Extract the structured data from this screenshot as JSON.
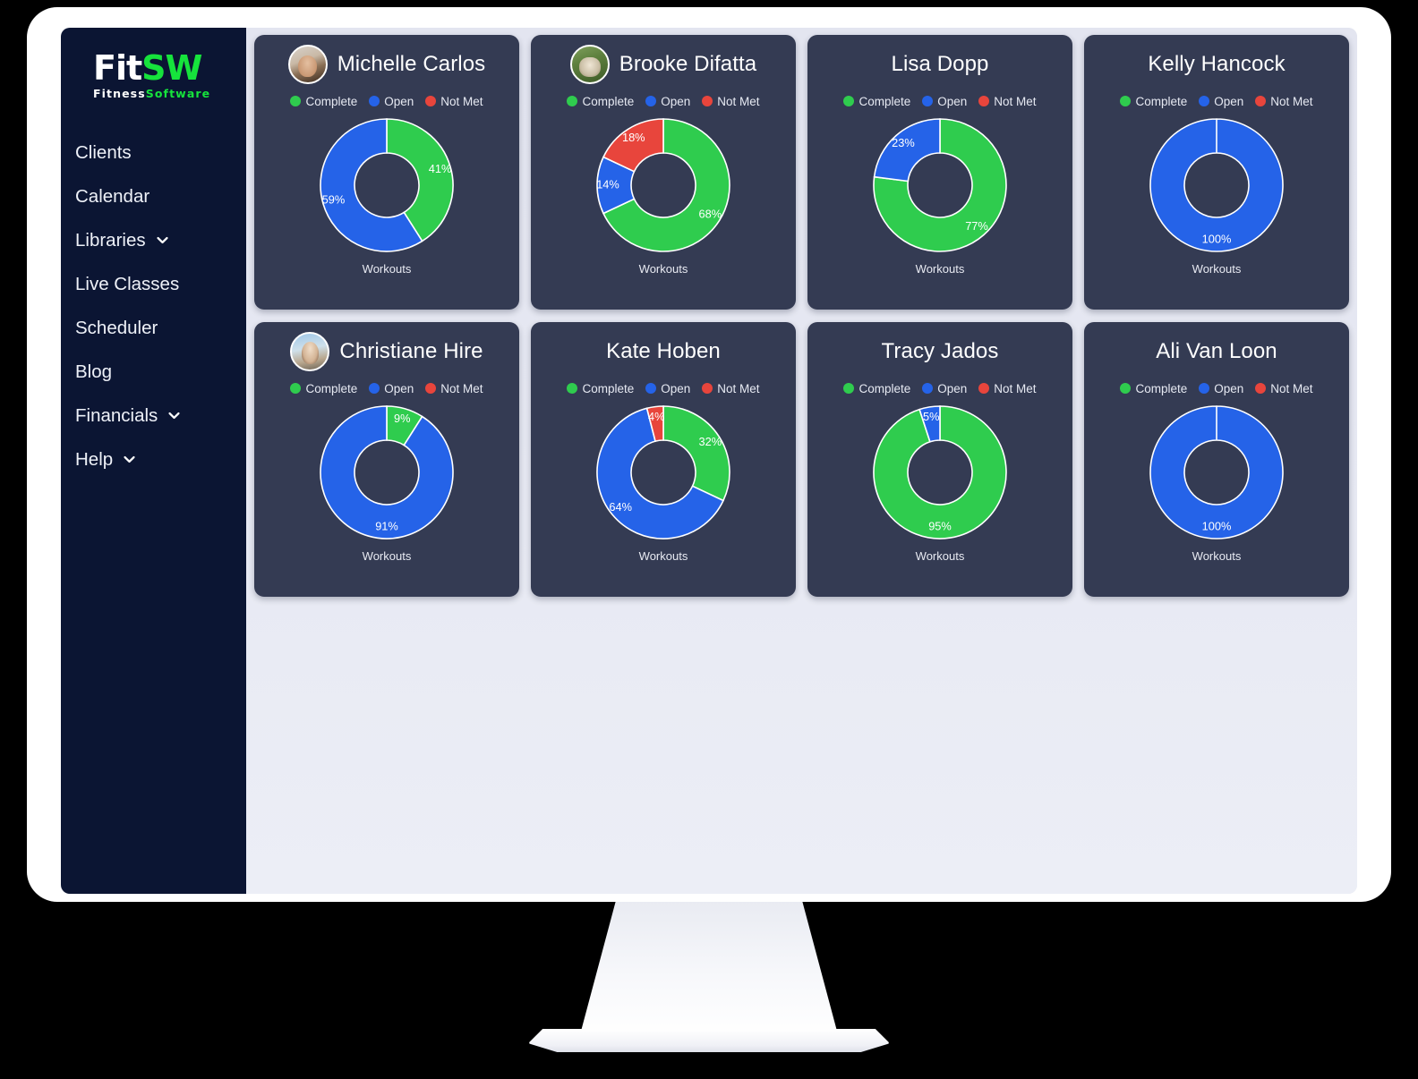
{
  "brand": {
    "logo_text_1": "Fit",
    "logo_text_2": "SW",
    "logo_sub_1": "Fitness",
    "logo_sub_2": "Software",
    "color_green": "#16e33c",
    "color_white": "#ffffff"
  },
  "sidebar": {
    "items": [
      {
        "label": "Clients",
        "has_chevron": false
      },
      {
        "label": "Calendar",
        "has_chevron": false
      },
      {
        "label": "Libraries",
        "has_chevron": true
      },
      {
        "label": "Live Classes",
        "has_chevron": false
      },
      {
        "label": "Scheduler",
        "has_chevron": false
      },
      {
        "label": "Blog",
        "has_chevron": false
      },
      {
        "label": "Financials",
        "has_chevron": true
      },
      {
        "label": "Help",
        "has_chevron": true
      }
    ]
  },
  "legend": {
    "complete": "Complete",
    "open": "Open",
    "not_met": "Not Met"
  },
  "colors": {
    "complete": "#2fcc4e",
    "open": "#2563e8",
    "not_met": "#e8453c",
    "card_bg": "#343b53",
    "sidebar_bg": "#0b1533",
    "page_bg": "#e3e5f0",
    "donut_hole": "#343b53",
    "separator": "#ffffff"
  },
  "chart_data": [
    {
      "type": "pie",
      "title": "Michelle Carlos",
      "caption": "Workouts",
      "has_avatar": true,
      "categories": [
        "Complete",
        "Open",
        "Not Met"
      ],
      "values": [
        41,
        59,
        0
      ],
      "labels": [
        "41%",
        "59%",
        ""
      ],
      "colors": [
        "#2fcc4e",
        "#2563e8",
        "#e8453c"
      ]
    },
    {
      "type": "pie",
      "title": "Brooke Difatta",
      "caption": "Workouts",
      "has_avatar": true,
      "categories": [
        "Complete",
        "Open",
        "Not Met"
      ],
      "values": [
        68,
        14,
        18
      ],
      "labels": [
        "68%",
        "14%",
        "18%"
      ],
      "colors": [
        "#2fcc4e",
        "#2563e8",
        "#e8453c"
      ]
    },
    {
      "type": "pie",
      "title": "Lisa Dopp",
      "caption": "Workouts",
      "has_avatar": false,
      "categories": [
        "Complete",
        "Open",
        "Not Met"
      ],
      "values": [
        77,
        23,
        0
      ],
      "labels": [
        "77%",
        "23%",
        ""
      ],
      "colors": [
        "#2fcc4e",
        "#2563e8",
        "#e8453c"
      ]
    },
    {
      "type": "pie",
      "title": "Kelly Hancock",
      "caption": "Workouts",
      "has_avatar": false,
      "categories": [
        "Complete",
        "Open",
        "Not Met"
      ],
      "values": [
        0,
        100,
        0
      ],
      "labels": [
        "",
        "100%",
        ""
      ],
      "colors": [
        "#2fcc4e",
        "#2563e8",
        "#e8453c"
      ]
    },
    {
      "type": "pie",
      "title": "Christiane Hire",
      "caption": "Workouts",
      "has_avatar": true,
      "categories": [
        "Complete",
        "Open",
        "Not Met"
      ],
      "values": [
        9,
        91,
        0
      ],
      "labels": [
        "9%",
        "91%",
        ""
      ],
      "colors": [
        "#2fcc4e",
        "#2563e8",
        "#e8453c"
      ]
    },
    {
      "type": "pie",
      "title": "Kate Hoben",
      "caption": "Workouts",
      "has_avatar": false,
      "categories": [
        "Complete",
        "Open",
        "Not Met"
      ],
      "values": [
        32,
        64,
        4
      ],
      "labels": [
        "32%",
        "64%",
        "4%"
      ],
      "colors": [
        "#2fcc4e",
        "#2563e8",
        "#e8453c"
      ]
    },
    {
      "type": "pie",
      "title": "Tracy Jados",
      "caption": "Workouts",
      "has_avatar": false,
      "categories": [
        "Complete",
        "Open",
        "Not Met"
      ],
      "values": [
        95,
        5,
        0
      ],
      "labels": [
        "95%",
        "5%",
        ""
      ],
      "colors": [
        "#2fcc4e",
        "#2563e8",
        "#e8453c"
      ]
    },
    {
      "type": "pie",
      "title": "Ali Van Loon",
      "caption": "Workouts",
      "has_avatar": false,
      "categories": [
        "Complete",
        "Open",
        "Not Met"
      ],
      "values": [
        0,
        100,
        0
      ],
      "labels": [
        "",
        "100%",
        ""
      ],
      "colors": [
        "#2fcc4e",
        "#2563e8",
        "#e8453c"
      ]
    }
  ]
}
